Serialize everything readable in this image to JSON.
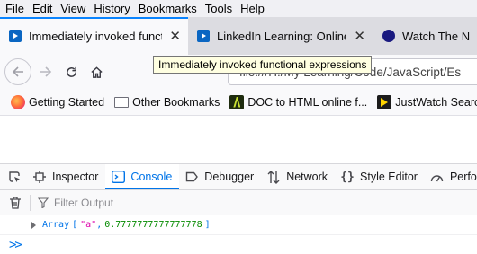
{
  "menubar": {
    "items": [
      "File",
      "Edit",
      "View",
      "History",
      "Bookmarks",
      "Tools",
      "Help"
    ]
  },
  "tabs": [
    {
      "title": "Immediately invoked functio",
      "active": true,
      "favicon": "linkedin-learning-icon"
    },
    {
      "title": "LinkedIn Learning: Online Co",
      "active": false,
      "favicon": "linkedin-learning-icon"
    },
    {
      "title": "Watch The Nut",
      "active": false,
      "favicon": "site-icon"
    }
  ],
  "tooltip": "Immediately invoked functional expressions",
  "navbar": {
    "url": "file:///H:/My Learning/Code/JavaScript/Es"
  },
  "bookmarks": [
    {
      "label": "Getting Started",
      "icon": "firefox-icon"
    },
    {
      "label": "Other Bookmarks",
      "icon": "folder-icon"
    },
    {
      "label": "DOC to HTML online f...",
      "icon": "doc-to-html-icon"
    },
    {
      "label": "JustWatch Search",
      "icon": "justwatch-icon"
    }
  ],
  "devtools": {
    "tabs": [
      {
        "label": "Inspector",
        "icon": "inspector-icon"
      },
      {
        "label": "Console",
        "icon": "console-icon",
        "selected": true
      },
      {
        "label": "Debugger",
        "icon": "debugger-icon"
      },
      {
        "label": "Network",
        "icon": "network-icon"
      },
      {
        "label": "Style Editor",
        "icon": "style-editor-icon"
      },
      {
        "label": "Perfo",
        "icon": "performance-icon"
      }
    ],
    "filter_placeholder": "Filter Output",
    "output": {
      "type_label": "Array",
      "open_bracket": "[",
      "string_value": "\"a\"",
      "comma": ",",
      "number_value": "0.7777777777777778",
      "close_bracket": "]"
    },
    "prompt": ">>"
  },
  "colors": {
    "accent": "#0074e8",
    "tab_highlight": "#0a84ff",
    "string": "#dd00a9",
    "number": "#058b00"
  }
}
